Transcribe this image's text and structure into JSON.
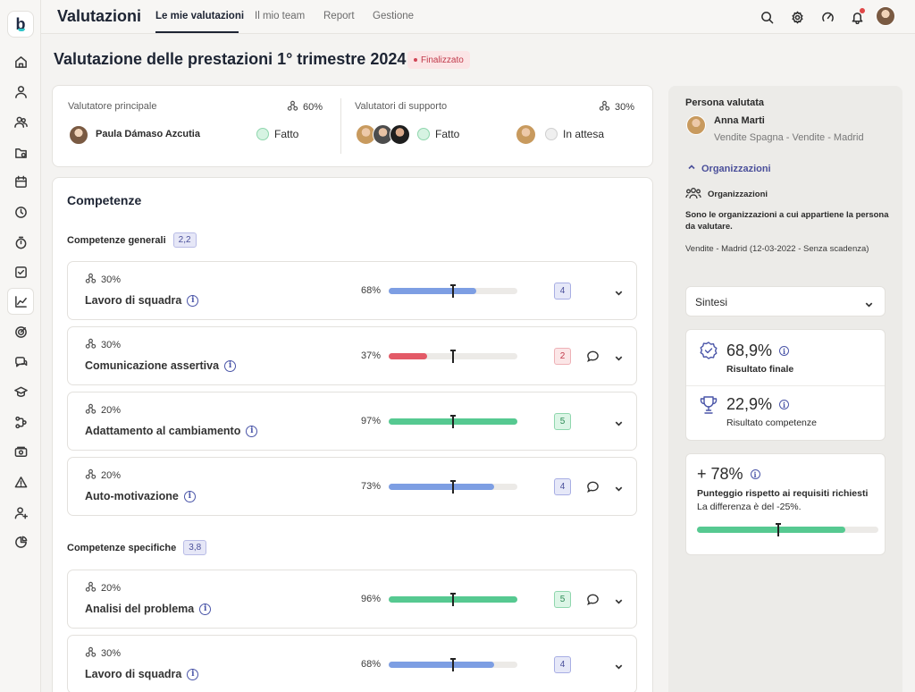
{
  "app": {
    "title": "Valutazioni"
  },
  "nav": {
    "tabs": [
      "Le mie valutazioni",
      "Il mio team",
      "Report",
      "Gestione"
    ]
  },
  "page": {
    "title": "Valutazione delle prestazioni 1° trimestre 2024",
    "status": "Finalizzato"
  },
  "evaluators": {
    "main_label": "Valutatore principale",
    "main_pct": "60%",
    "main_name": "Paula Dámaso Azcutia",
    "main_status": "Fatto",
    "support_label": "Valutatori di supporto",
    "support_pct": "30%",
    "support_status_done": "Fatto",
    "support_status_wait": "In attesa"
  },
  "competences": {
    "title": "Competenze",
    "general": {
      "title": "Competenze generali",
      "badge": "2,2",
      "items": [
        {
          "weight": "30%",
          "name": "Lavoro di squadra",
          "pct": "68%",
          "value": 68,
          "score": "4",
          "color": "blue",
          "comment": false
        },
        {
          "weight": "30%",
          "name": "Comunicazione assertiva",
          "pct": "37%",
          "value": 30,
          "score": "2",
          "color": "red",
          "comment": true
        },
        {
          "weight": "20%",
          "name": "Adattamento al cambiamento",
          "pct": "97%",
          "value": 100,
          "score": "5",
          "color": "green",
          "comment": false
        },
        {
          "weight": "20%",
          "name": "Auto-motivazione",
          "pct": "73%",
          "value": 82,
          "score": "4",
          "color": "blue",
          "comment": true
        }
      ]
    },
    "specific": {
      "title": "Competenze specifiche",
      "badge": "3,8",
      "items": [
        {
          "weight": "20%",
          "name": "Analisi del problema",
          "pct": "96%",
          "value": 100,
          "score": "5",
          "color": "green",
          "comment": true
        },
        {
          "weight": "30%",
          "name": "Lavoro di squadra",
          "pct": "68%",
          "value": 82,
          "score": "4",
          "color": "blue",
          "comment": false
        }
      ]
    }
  },
  "colors": {
    "blue": "#7d9ee3",
    "red": "#e35a67",
    "green": "#56c991",
    "accent": "#4a4f9a"
  },
  "person": {
    "label": "Persona valutata",
    "name": "Anna Marti",
    "dept": "Vendite Spagna - Vendite - Madrid",
    "org_toggle": "Organizzazioni",
    "org_title": "Organizzazioni",
    "org_desc": "Sono le organizzazioni a cui appartiene la persona da valutare.",
    "org_item": "Vendite - Madrid (12-03-2022 - Senza scadenza)"
  },
  "summary": {
    "select_value": "Sintesi",
    "final_value": "68,9%",
    "final_label": "Risultato finale",
    "comp_value": "22,9%",
    "comp_label": "Risultato competenze",
    "req_value": "+ 78%",
    "req_title": "Punteggio rispetto ai requisiti richiesti",
    "req_diff": "La differenza è del -25%.",
    "req_bar_value": 82
  }
}
